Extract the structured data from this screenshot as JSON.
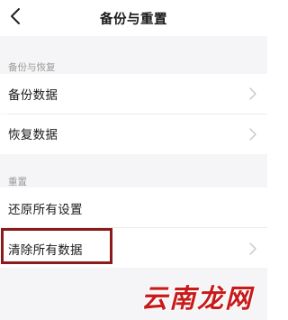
{
  "header": {
    "title": "备份与重置",
    "back_icon": "chevron-left-icon"
  },
  "sections": [
    {
      "label": "备份与恢复",
      "items": [
        {
          "label": "备份数据",
          "icon": "chevron-right-icon"
        },
        {
          "label": "恢复数据",
          "icon": "chevron-right-icon"
        }
      ]
    },
    {
      "label": "重置",
      "items": [
        {
          "label": "还原所有设置"
        },
        {
          "label": "清除所有数据",
          "icon": "chevron-right-icon"
        }
      ]
    }
  ],
  "highlight": {
    "color": "#8b1a1a",
    "target": "清除所有数据"
  },
  "watermark": {
    "text": "云南龙网",
    "color": "#c81a1a"
  }
}
